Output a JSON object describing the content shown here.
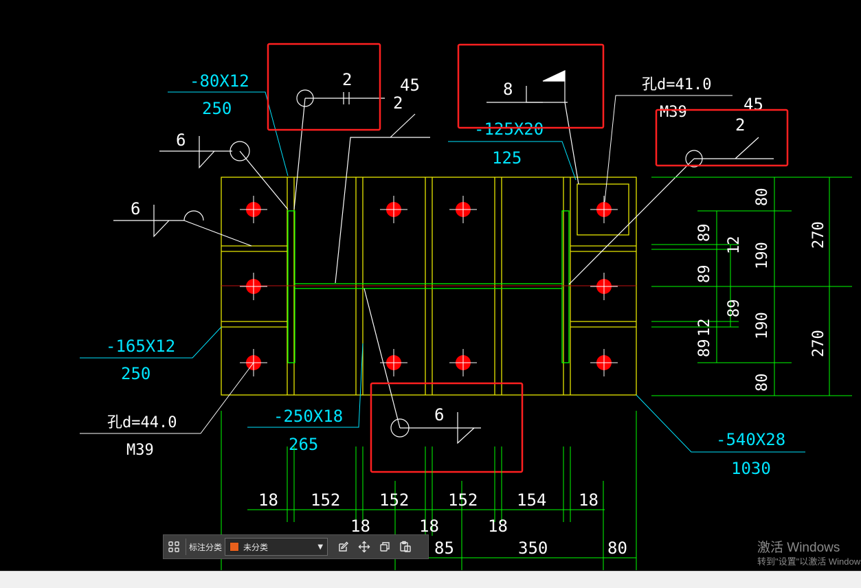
{
  "drawing": {
    "plate_labels": {
      "a_top": "-80X12",
      "a_bot": "250",
      "b_top": "-125X20",
      "b_bot": "125",
      "c_top": "-165X12",
      "c_bot": "250",
      "d_top": "-250X18",
      "d_bot": "265",
      "e_top": "-540X28",
      "e_bot": "1030"
    },
    "hole_labels": {
      "left_top": "孔d=44.0",
      "left_bot": "M39",
      "right_top": "孔d=41.0",
      "right_bot": "M39"
    },
    "weld_labels": {
      "w_6a": "6",
      "w_6b": "6",
      "w_6c": "6",
      "w_8": "8",
      "w_2a": "2",
      "w_2b": "2",
      "w_2c": "2",
      "w_45a": "45",
      "w_45b": "45"
    },
    "dims_right": {
      "d80a": "80",
      "d190a": "190",
      "d190b": "190",
      "d80b": "80",
      "d270a": "270",
      "d270b": "270",
      "d89a": "89",
      "d89b": "89",
      "d89c": "89",
      "d89d": "89",
      "d12a": "12",
      "d12b": "12"
    },
    "dims_bottom": {
      "b18a": "18",
      "b152a": "152",
      "b152b": "152",
      "b152c": "152",
      "b154": "154",
      "b18b": "18",
      "b18c": "18",
      "b18d": "18",
      "b18e": "18",
      "b85": "85",
      "b350": "350",
      "b80": "80"
    },
    "colors": {
      "outline": "#e8e800",
      "dimension": "#00ff00",
      "label": "#00e5ff",
      "text": "#ffffff",
      "bolt": "#ff0000",
      "highlight": "#ff2020"
    }
  },
  "toolbar": {
    "category_label": "标注分类",
    "category_value": "未分类",
    "icons": [
      "grid-icon",
      "edit-icon",
      "move-icon",
      "copy-icon",
      "paste-icon"
    ]
  },
  "watermark": {
    "title": "激活 Windows",
    "subtitle": "转到\"设置\"以激活 Windows。"
  }
}
